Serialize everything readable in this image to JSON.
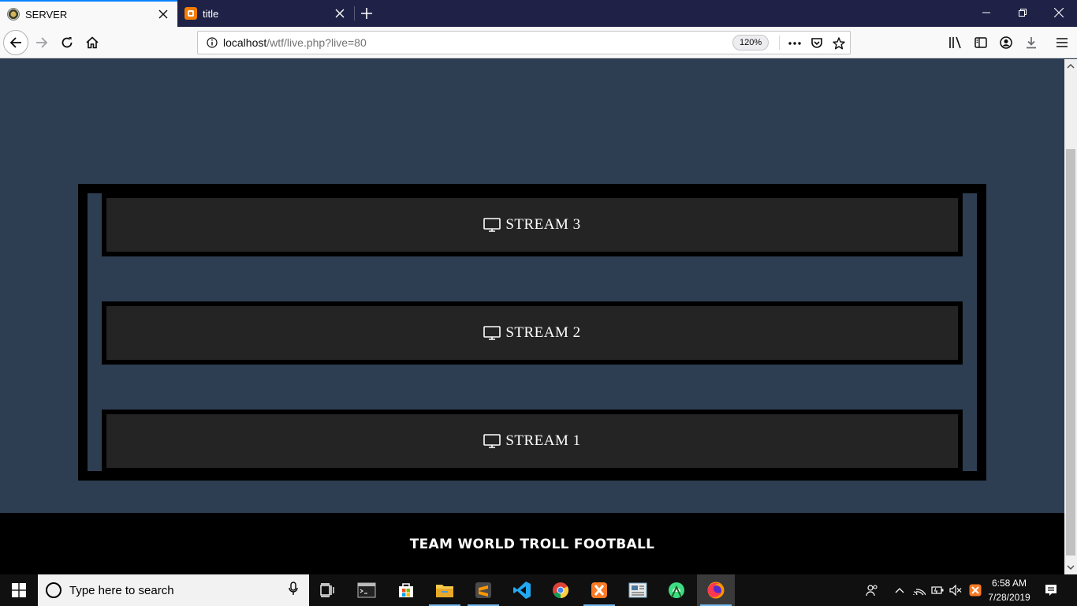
{
  "browser": {
    "tabs": [
      {
        "title": "SERVER",
        "active": true
      },
      {
        "title": "title",
        "active": false
      }
    ],
    "url": {
      "host": "localhost",
      "path": "/wtf/live.php?live=80"
    },
    "zoom": "120%"
  },
  "page": {
    "streams": [
      {
        "label": "STREAM 3"
      },
      {
        "label": "STREAM 2"
      },
      {
        "label": "STREAM 1"
      }
    ],
    "footer": "TEAM WORLD TROLL FOOTBALL",
    "colors": {
      "background": "#2e3e52",
      "button": "#242424",
      "frame": "#000000"
    }
  },
  "taskbar": {
    "search_placeholder": "Type here to search",
    "time": "6:58 AM",
    "date": "7/28/2019"
  }
}
